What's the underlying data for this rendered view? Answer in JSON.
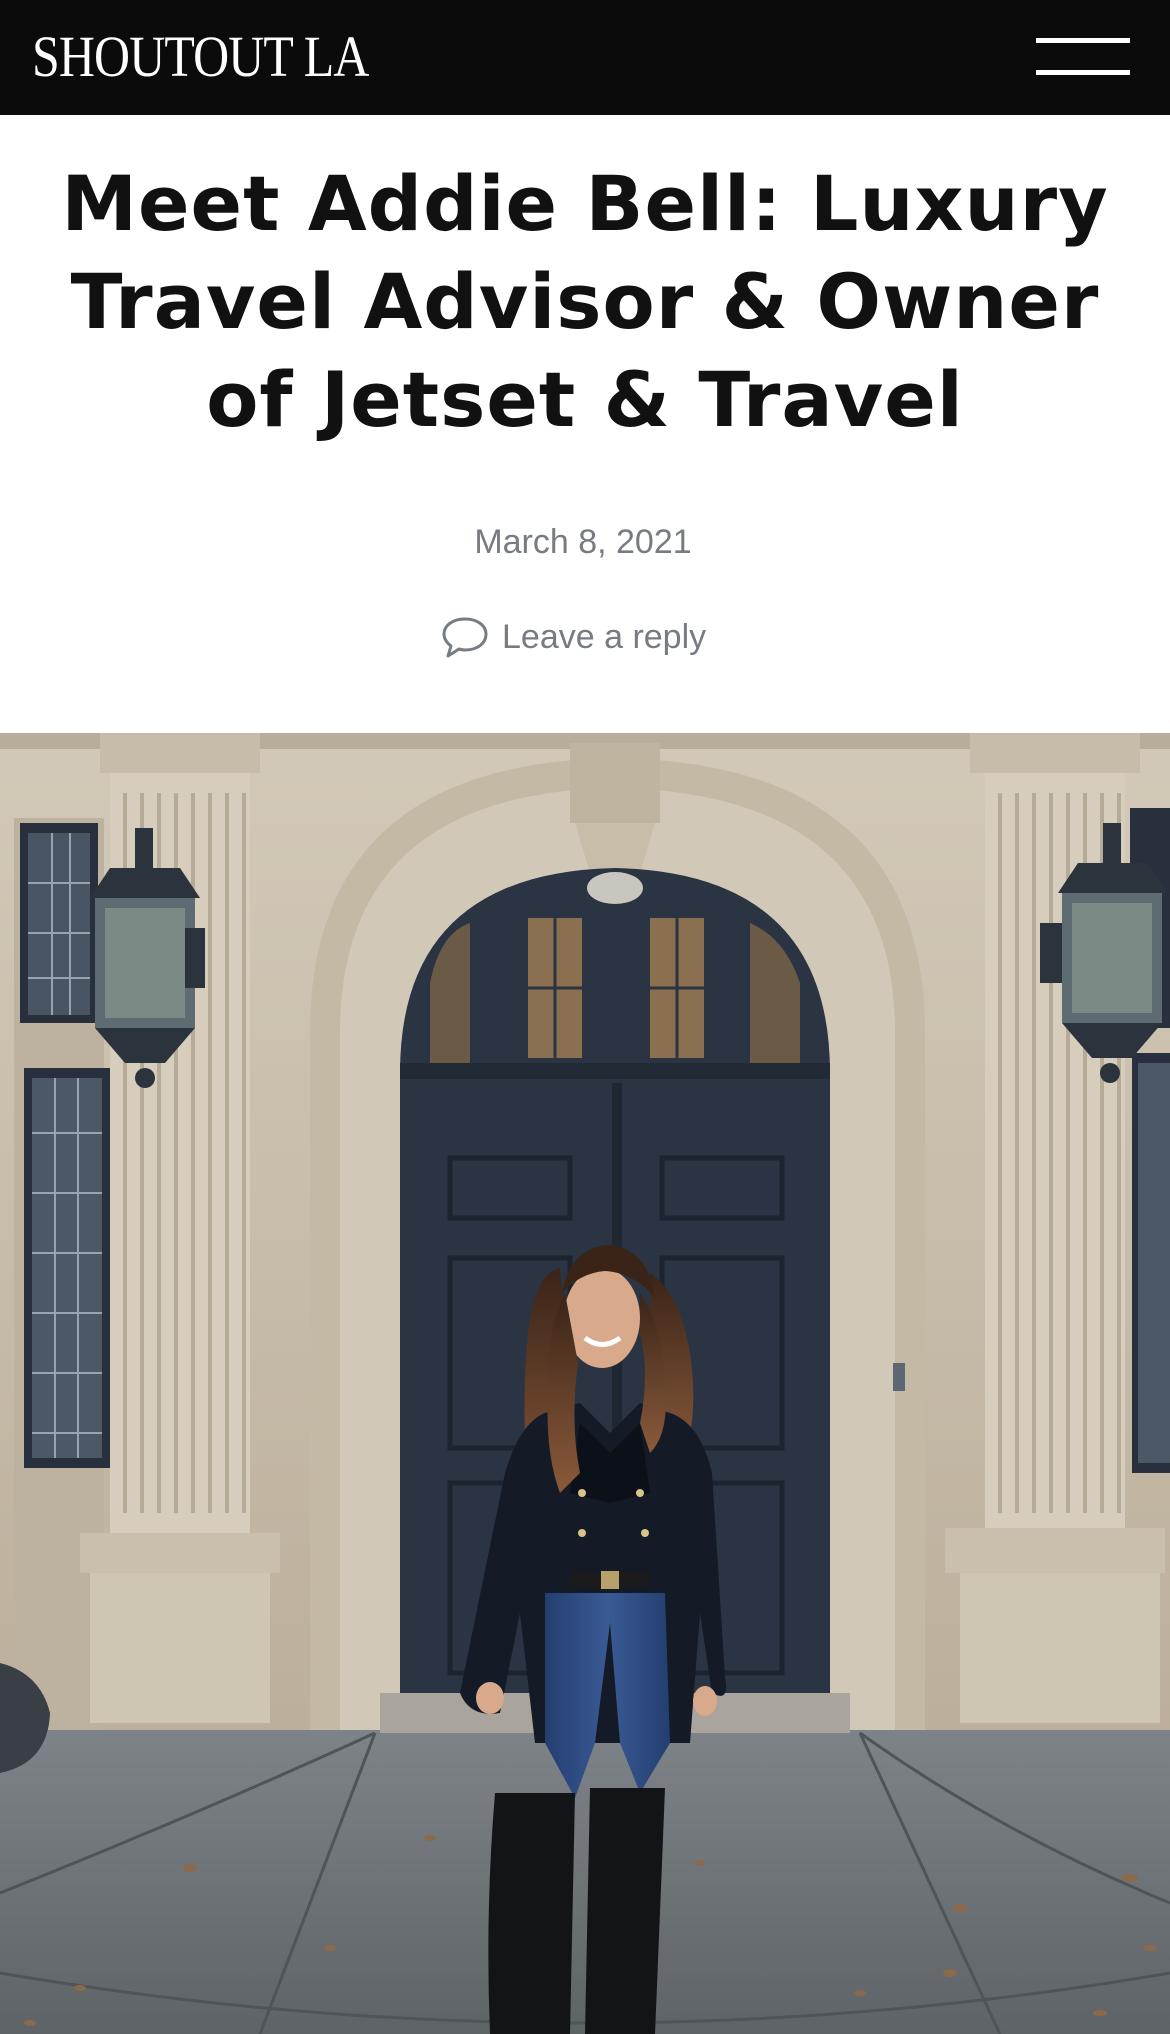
{
  "header": {
    "logo": "SHOUTOUT LA",
    "menu_icon": "hamburger-menu-icon"
  },
  "article": {
    "title": "Meet Addie Bell: Luxury Travel Advisor & Owner of Jetset & Travel",
    "date": "March 8, 2021",
    "reply_label": "Leave a reply",
    "reply_icon": "speech-bubble-icon"
  },
  "photo": {
    "subject": "woman standing in front of arched dark door",
    "colors": {
      "stone": "#cdc2b0",
      "door": "#2b3442",
      "pavement": "#6f7478"
    }
  }
}
